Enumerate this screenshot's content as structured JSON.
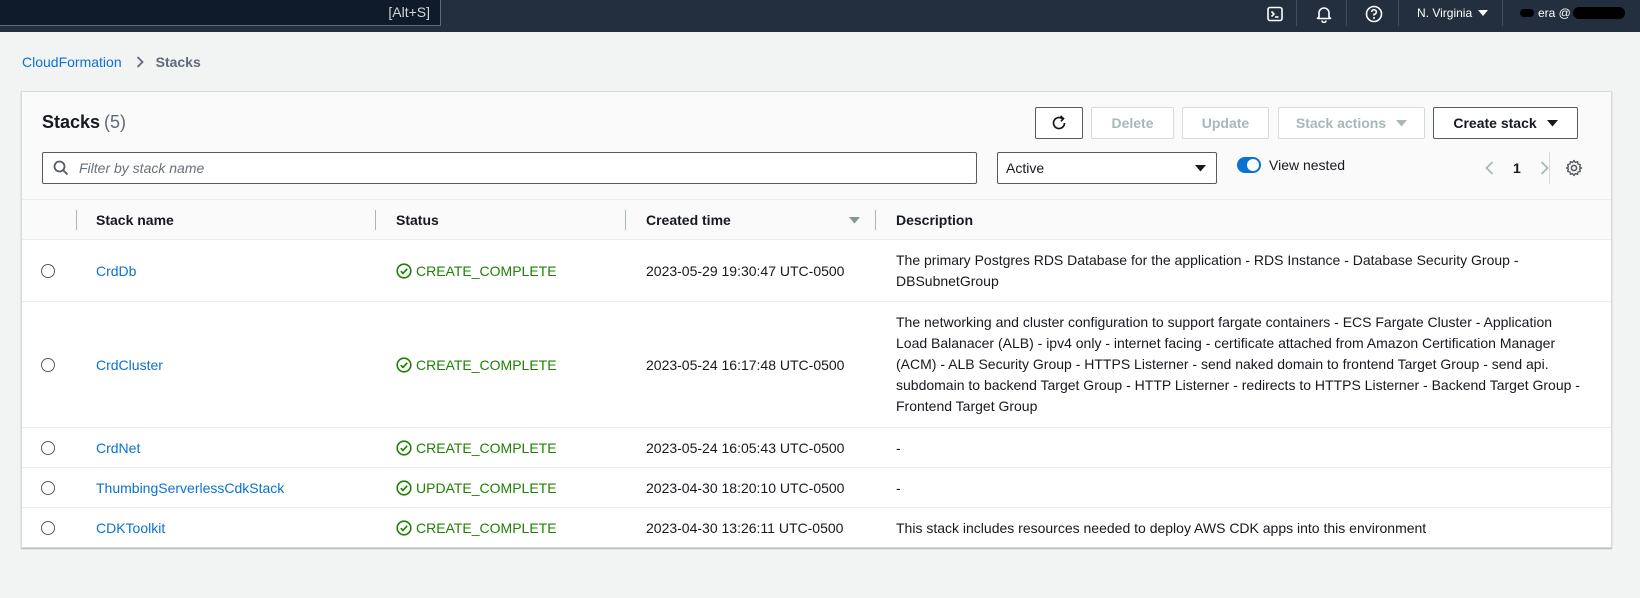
{
  "topnav": {
    "search_shortcut": "[Alt+S]",
    "region": "N. Virginia",
    "account": "era @"
  },
  "breadcrumb": {
    "root": "CloudFormation",
    "current": "Stacks"
  },
  "panel": {
    "title": "Stacks",
    "count": "(5)",
    "buttons": {
      "delete": "Delete",
      "update": "Update",
      "stack_actions": "Stack actions",
      "create_stack": "Create stack"
    },
    "filter_placeholder": "Filter by stack name",
    "status_filter": "Active",
    "view_nested": "View nested",
    "page": "1"
  },
  "table": {
    "columns": [
      "Stack name",
      "Status",
      "Created time",
      "Description"
    ],
    "rows": [
      {
        "name": "CrdDb",
        "status": "CREATE_COMPLETE",
        "created": "2023-05-29 19:30:47 UTC-0500",
        "description": "The primary Postgres RDS Database for the application - RDS Instance - Database Security Group - DBSubnetGroup"
      },
      {
        "name": "CrdCluster",
        "status": "CREATE_COMPLETE",
        "created": "2023-05-24 16:17:48 UTC-0500",
        "description": "The networking and cluster configuration to support fargate containers - ECS Fargate Cluster - Application Load Balanacer (ALB) - ipv4 only - internet facing - certificate attached from Amazon Certification Manager (ACM) - ALB Security Group - HTTPS Listerner - send naked domain to frontend Target Group - send api. subdomain to backend Target Group - HTTP Listerner - redirects to HTTPS Listerner - Backend Target Group - Frontend Target Group"
      },
      {
        "name": "CrdNet",
        "status": "CREATE_COMPLETE",
        "created": "2023-05-24 16:05:43 UTC-0500",
        "description": "-"
      },
      {
        "name": "ThumbingServerlessCdkStack",
        "status": "UPDATE_COMPLETE",
        "created": "2023-04-30 18:20:10 UTC-0500",
        "description": "-"
      },
      {
        "name": "CDKToolkit",
        "status": "CREATE_COMPLETE",
        "created": "2023-04-30 13:26:11 UTC-0500",
        "description": "This stack includes resources needed to deploy AWS CDK apps into this environment"
      }
    ]
  },
  "colors": {
    "nav_bg": "#232f3e",
    "link": "#0972d3",
    "success": "#1d8102"
  }
}
